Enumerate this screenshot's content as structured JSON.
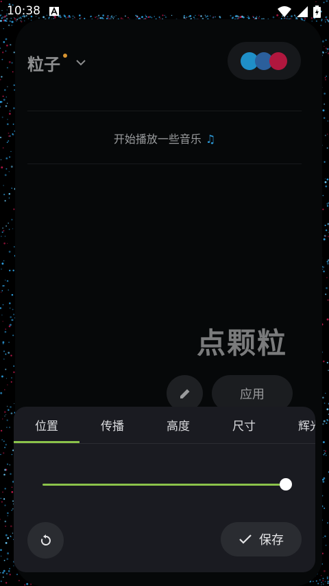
{
  "status_bar": {
    "time": "10:38"
  },
  "header": {
    "title": "粒子"
  },
  "theme_colors": [
    "#1f8fc8",
    "#2b5f9c",
    "#b0173e"
  ],
  "now_playing": {
    "text": "开始播放一些音乐",
    "icon": "music-note-icon"
  },
  "preview": {
    "title": "点颗粒"
  },
  "actions": {
    "apply_label": "应用"
  },
  "sheet": {
    "tabs": [
      "位置",
      "传播",
      "高度",
      "尺寸",
      "辉光"
    ],
    "selected_tab": 0,
    "slider_value": 1.0,
    "save_label": "保存"
  },
  "accent": "#8bc34a"
}
